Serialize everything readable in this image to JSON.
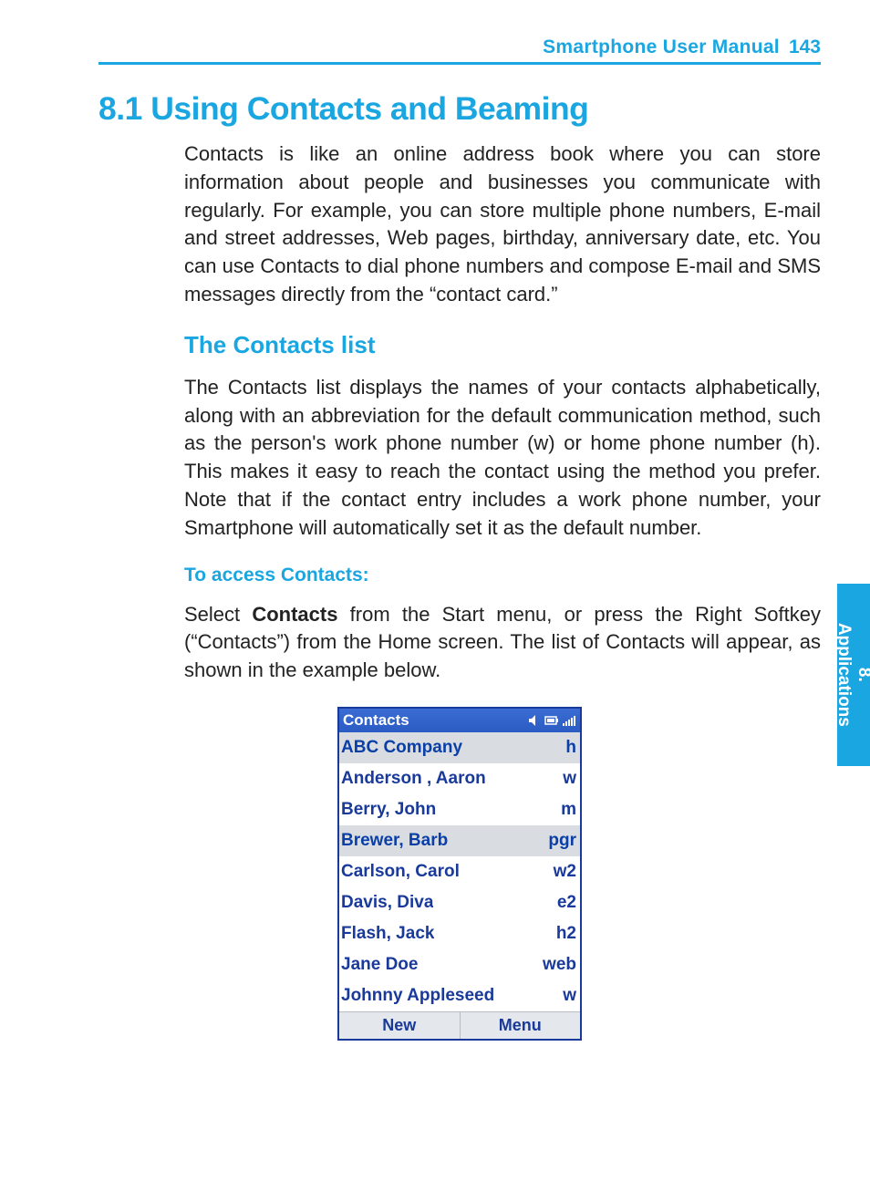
{
  "header": {
    "title": "Smartphone User Manual",
    "page": "143"
  },
  "side_tab": {
    "chapter": "8.",
    "label": "Applications"
  },
  "h1": "8.1  Using Contacts and Beaming",
  "intro": "Contacts is like an online address book where you can store information about people and businesses you communicate with regularly.  For example, you can store multiple phone numbers, E-mail and street addresses, Web pages, birthday, anniversary date, etc.  You can use Contacts to dial phone numbers and compose E-mail and SMS messages directly from the “contact card.”",
  "h2": "The Contacts list",
  "para2": "The Contacts list displays the names of your contacts alphabetically, along with an abbreviation for the default communication method, such as the person's work phone number (w) or home phone number (h).  This makes it easy to reach the contact using the method you prefer.  Note that if the contact entry includes a work phone number, your Smartphone will automatically set it as the default number.",
  "h3": "To access Contacts:",
  "para3_pre": "Select ",
  "para3_bold": "Contacts",
  "para3_post": " from the Start menu, or press the Right Softkey (“Contacts”) from the Home screen.  The list of Contacts will appear, as shown in the example below.",
  "phone": {
    "title": "Contacts",
    "rows": [
      {
        "name": "ABC Company",
        "code": "h",
        "highlight": true
      },
      {
        "name": "Anderson , Aaron",
        "code": "w",
        "highlight": false
      },
      {
        "name": "Berry, John",
        "code": "m",
        "highlight": false
      },
      {
        "name": "Brewer, Barb",
        "code": "pgr",
        "highlight": true
      },
      {
        "name": "Carlson, Carol",
        "code": "w2",
        "highlight": false
      },
      {
        "name": "Davis, Diva",
        "code": "e2",
        "highlight": false
      },
      {
        "name": "Flash, Jack",
        "code": "h2",
        "highlight": false
      },
      {
        "name": "Jane Doe",
        "code": "web",
        "highlight": false
      },
      {
        "name": "Johnny Appleseed",
        "code": "w",
        "highlight": false
      }
    ],
    "softkeys": {
      "left": "New",
      "right": "Menu"
    }
  }
}
